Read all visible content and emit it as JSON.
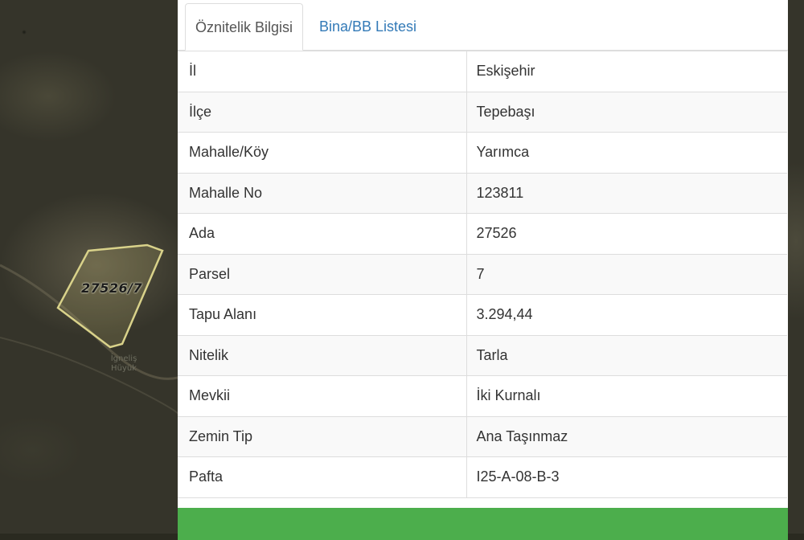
{
  "map": {
    "parcel_label": "27526/7",
    "place_label": "İgneliş Hüyük"
  },
  "tabs": [
    {
      "label": "Öznitelik Bilgisi",
      "active": true
    },
    {
      "label": "Bina/BB Listesi",
      "active": false
    }
  ],
  "attributes": [
    {
      "key": "İl",
      "value": "Eskişehir"
    },
    {
      "key": "İlçe",
      "value": "Tepebaşı"
    },
    {
      "key": "Mahalle/Köy",
      "value": "Yarımca"
    },
    {
      "key": "Mahalle No",
      "value": "123811"
    },
    {
      "key": "Ada",
      "value": "27526"
    },
    {
      "key": "Parsel",
      "value": "7"
    },
    {
      "key": "Tapu Alanı",
      "value": "3.294,44"
    },
    {
      "key": "Nitelik",
      "value": "Tarla"
    },
    {
      "key": "Mevkii",
      "value": "İki Kurnalı"
    },
    {
      "key": "Zemin Tip",
      "value": "Ana Taşınmaz"
    },
    {
      "key": "Pafta",
      "value": "I25-A-08-B-3"
    }
  ],
  "colors": {
    "tab_link": "#337ab7",
    "action_button": "#4cae4c",
    "parcel_outline": "#d9d28a"
  }
}
